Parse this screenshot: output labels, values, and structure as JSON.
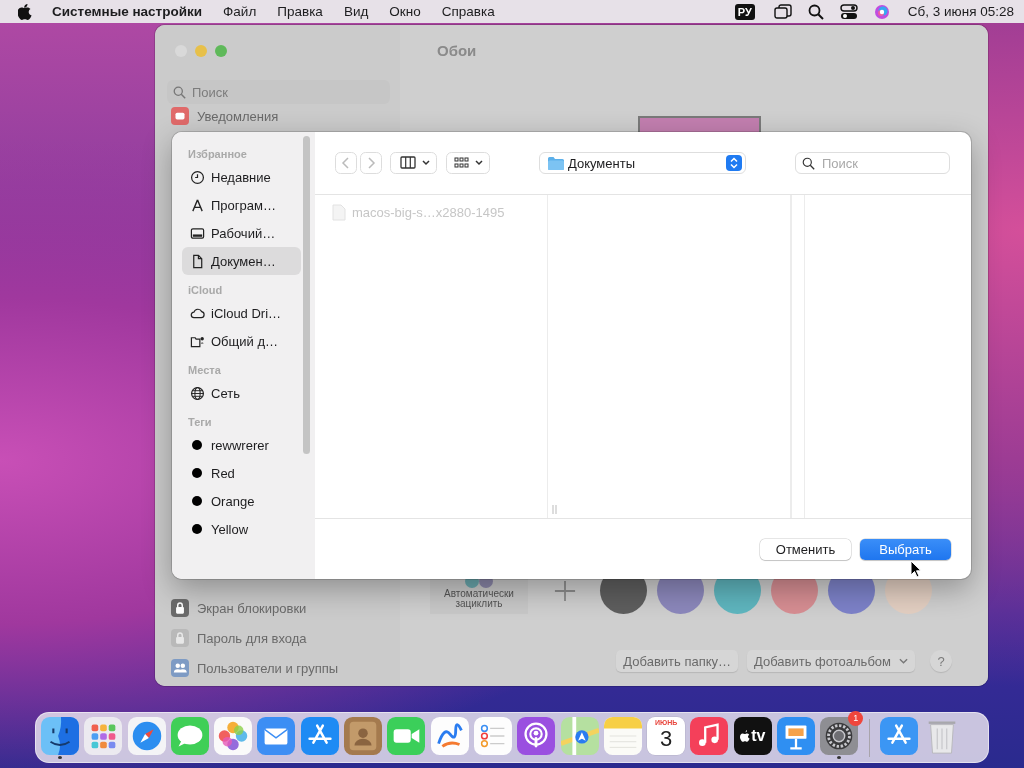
{
  "menu_bar": {
    "app_name": "Системные настройки",
    "menus": [
      "Файл",
      "Правка",
      "Вид",
      "Окно",
      "Справка"
    ],
    "input_source": "РУ",
    "clock": "Сб, 3 июня  05:28"
  },
  "settings_window": {
    "title": "Обои",
    "search": {
      "placeholder": "Поиск"
    },
    "sidebar_top": [
      {
        "label": "Уведомления",
        "kind": "notifications"
      }
    ],
    "sidebar_bottom": [
      {
        "label": "Экран блокировки",
        "kind": "lock_screen"
      },
      {
        "label": "Пароль для входа",
        "kind": "password"
      },
      {
        "label": "Пользователи и группы",
        "kind": "users"
      }
    ],
    "auto_cycle_label": "Автоматически зациклить",
    "swatches": [
      {
        "color": "#5e5e5e"
      },
      {
        "color": "#8c88bc"
      },
      {
        "color": "#5fb6bf"
      },
      {
        "color": "#d78e93"
      },
      {
        "color": "#7d82c9"
      },
      {
        "color": "#e3cfc2"
      }
    ],
    "buttons": [
      {
        "label": "Добавить папку…",
        "kind": "plain"
      },
      {
        "label": "Добавить фотоальбом",
        "kind": "dropdown"
      }
    ],
    "help": "?"
  },
  "dialog": {
    "sidebar": [
      {
        "heading": "Избранное",
        "items": [
          {
            "label": "Недавние",
            "kind": "recents",
            "selected": false
          },
          {
            "label": "Програм…",
            "kind": "applications",
            "selected": false
          },
          {
            "label": "Рабочий…",
            "kind": "desktop",
            "selected": false
          },
          {
            "label": "Докумен…",
            "kind": "document",
            "selected": true
          }
        ]
      },
      {
        "heading": "iCloud",
        "items": [
          {
            "label": "iCloud Dri…",
            "kind": "cloud",
            "selected": false
          },
          {
            "label": "Общий д…",
            "kind": "shared_folder",
            "selected": false
          }
        ]
      },
      {
        "heading": "Места",
        "items": [
          {
            "label": "Сеть",
            "kind": "network",
            "selected": false
          }
        ]
      },
      {
        "heading": "Теги",
        "items": [
          {
            "label": "rewwrerer",
            "kind": "tag",
            "color": "#000000",
            "selected": false
          },
          {
            "label": "Red",
            "kind": "tag",
            "color": "#000000",
            "selected": false
          },
          {
            "label": "Orange",
            "kind": "tag",
            "color": "#000000",
            "selected": false
          },
          {
            "label": "Yellow",
            "kind": "tag",
            "color": "#000000",
            "selected": false
          }
        ]
      }
    ],
    "location": "Документы",
    "search": {
      "placeholder": "Поиск"
    },
    "file": {
      "name": "macos-big-s…x2880-1495",
      "disabled": true
    },
    "buttons": [
      {
        "label": "Отменить",
        "default": false
      },
      {
        "label": "Выбрать",
        "default": true
      }
    ]
  },
  "dock": {
    "items": [
      {
        "kind": "finder",
        "running": true
      },
      {
        "kind": "launchpad",
        "running": false
      },
      {
        "kind": "safari",
        "running": false
      },
      {
        "kind": "messages",
        "running": false
      },
      {
        "kind": "photos",
        "running": false
      },
      {
        "kind": "mail",
        "running": false
      },
      {
        "kind": "appstore",
        "running": false
      },
      {
        "kind": "contacts",
        "running": false
      },
      {
        "kind": "facetime",
        "running": false
      },
      {
        "kind": "freeform",
        "running": false
      },
      {
        "kind": "reminders",
        "running": false
      },
      {
        "kind": "podcasts",
        "running": false
      },
      {
        "kind": "maps",
        "running": false
      },
      {
        "kind": "notes",
        "running": false
      },
      {
        "kind": "calendar",
        "month": "ИЮНЬ",
        "day": "3",
        "running": false
      },
      {
        "kind": "music",
        "running": false
      },
      {
        "kind": "tv",
        "label": "tv",
        "running": false
      },
      {
        "kind": "keynote",
        "running": false
      },
      {
        "kind": "settings",
        "badge": "1",
        "running": true
      },
      {
        "kind": "separator"
      },
      {
        "kind": "downloads",
        "running": false
      },
      {
        "kind": "trash",
        "running": false
      }
    ]
  }
}
